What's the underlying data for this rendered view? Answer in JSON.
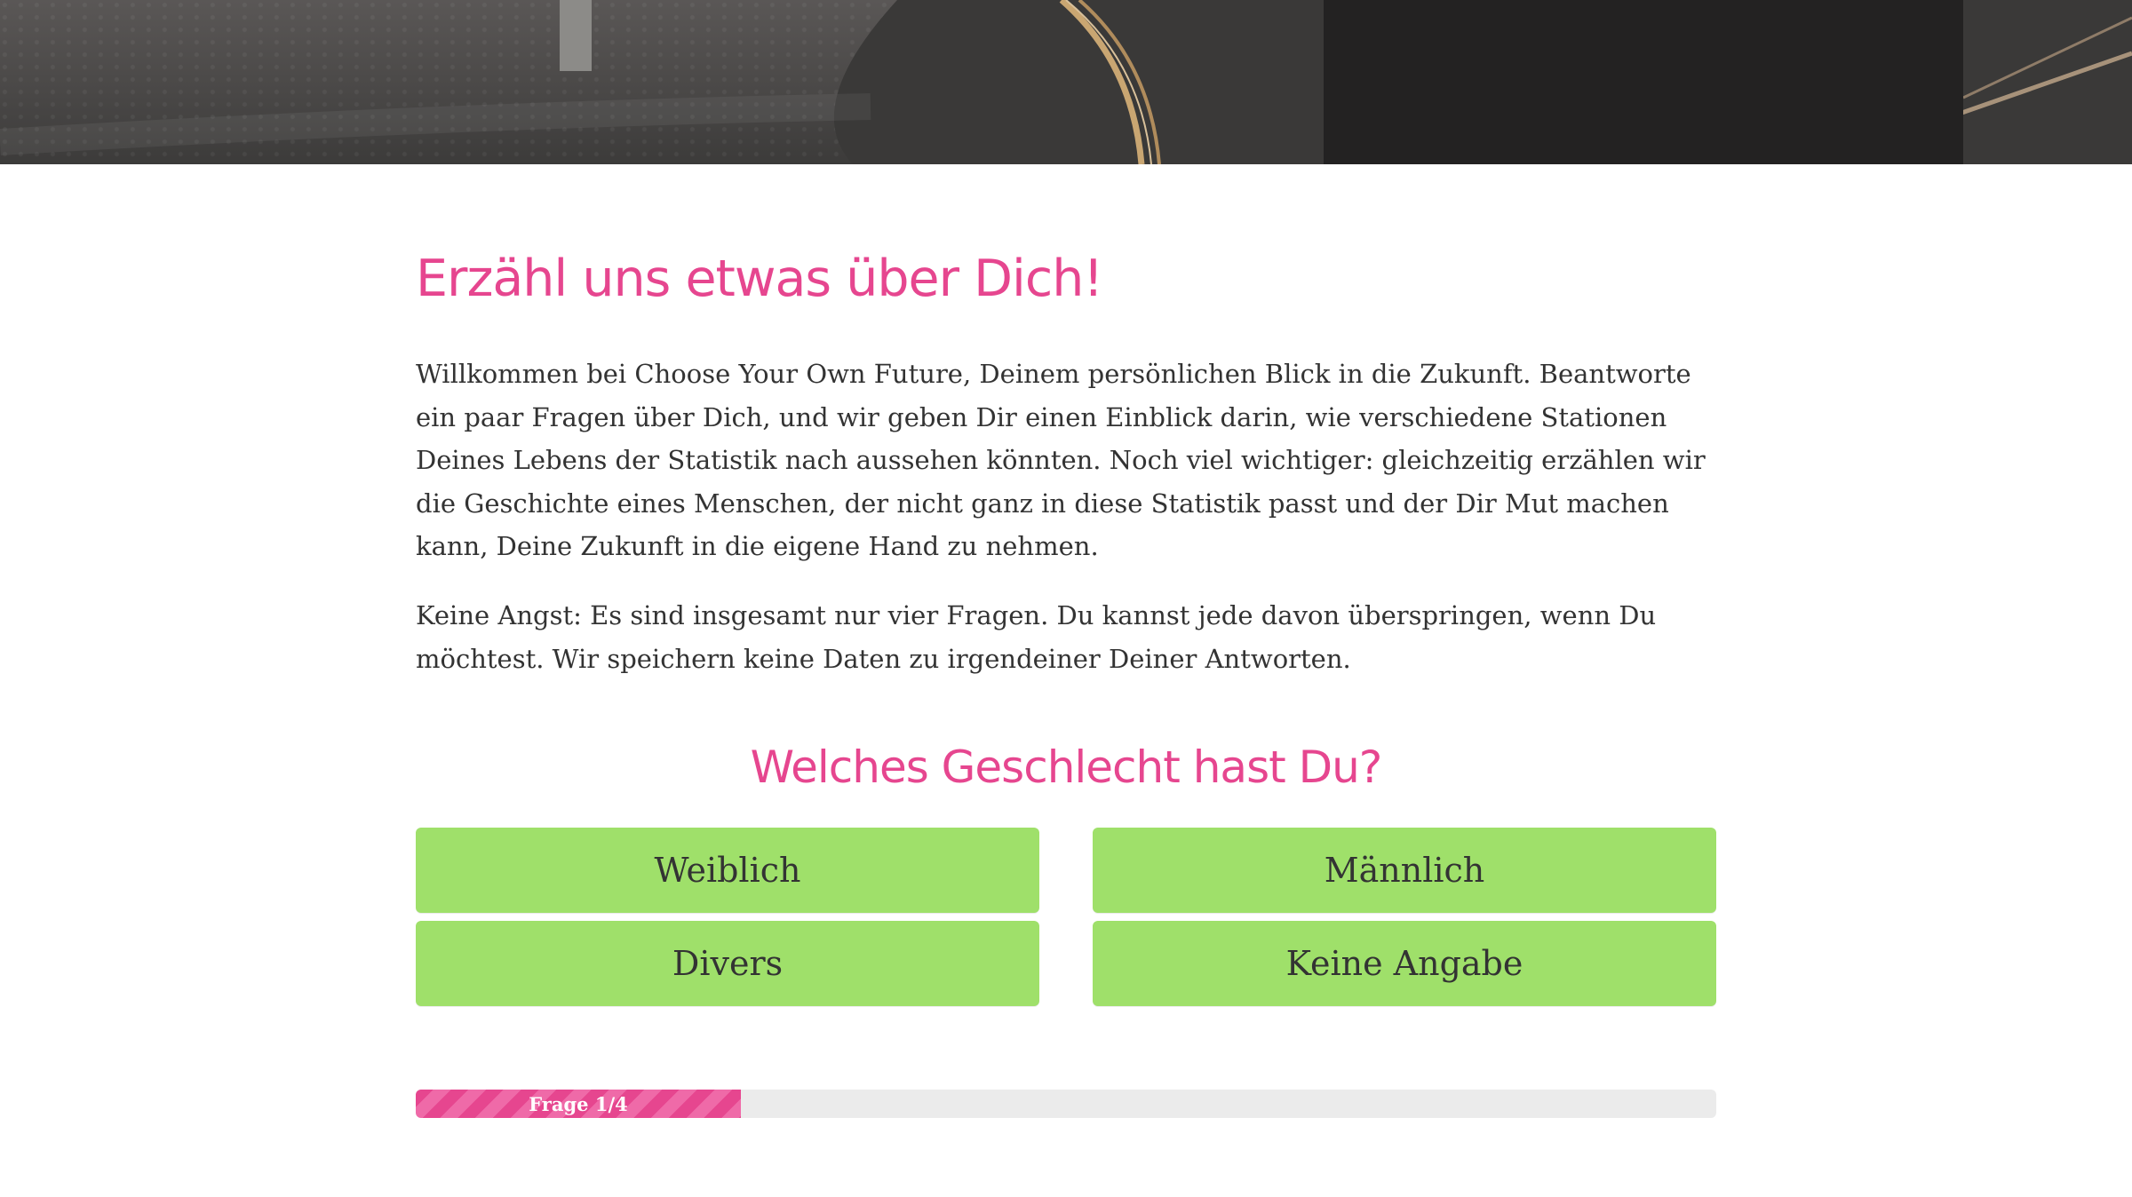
{
  "intro": {
    "title": "Erzähl uns etwas über Dich!",
    "paragraph_1": "Willkommen bei Choose Your Own Future, Deinem persönlichen Blick in die Zukunft. Beantworte ein paar Fragen über Dich, und wir geben Dir einen Einblick darin, wie verschiedene Stationen Deines Lebens der Statistik nach aussehen könnten. Noch viel wichtiger: gleichzeitig erzählen wir die Geschichte eines Menschen, der nicht ganz in diese Statistik passt und der Dir Mut machen kann, Deine Zukunft in die eigene Hand zu nehmen.",
    "paragraph_2": "Keine Angst: Es sind insgesamt nur vier Fragen. Du kannst jede davon überspringen, wenn Du möchtest. Wir speichern keine Daten zu irgendeiner Deiner Antworten."
  },
  "question": {
    "text": "Welches Geschlecht hast Du?",
    "answers": [
      "Weiblich",
      "Männlich",
      "Divers",
      "Keine Angabe"
    ]
  },
  "progress": {
    "label": "Frage 1/4",
    "current": 1,
    "total": 4,
    "fraction": 0.25
  },
  "colors": {
    "accent": "#e6468f",
    "answer_button": "#9fe06a",
    "text": "#333333",
    "progress_track": "#ebebeb"
  }
}
